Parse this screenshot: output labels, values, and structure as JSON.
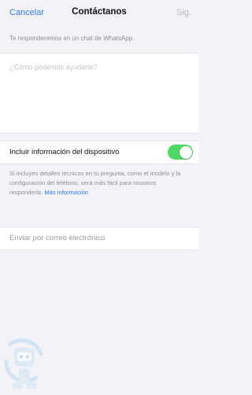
{
  "nav": {
    "cancel_label": "Cancelar",
    "title": "Contáctanos",
    "next_label": "Sig."
  },
  "intro_text": "Te responderemos en un chat de WhatsApp.",
  "message": {
    "placeholder": "¿Cómo podemos ayudarte?",
    "value": ""
  },
  "device_info": {
    "label": "Incluir información del dispositivo",
    "enabled": true
  },
  "help": {
    "text": "Si incluyes detalles técnicos en tu pregunta, como el modelo y la configuración del teléfono, será más fácil para nosotros responderla. ",
    "link_label": "Más información"
  },
  "email_option": {
    "label": "Enviar por correo electrónico"
  },
  "watermark": {
    "icon": "robot-mascot-icon"
  },
  "colors": {
    "accent": "#2f7cf6",
    "toggle_on": "#4cd964",
    "background": "#f2f2f7",
    "disabled_text": "#b9b9bd"
  }
}
